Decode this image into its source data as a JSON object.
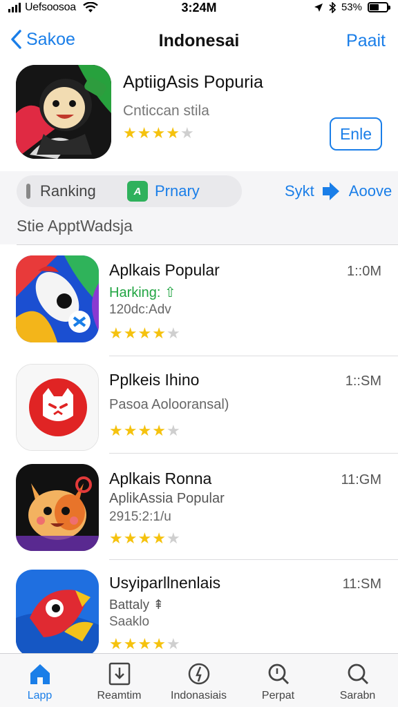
{
  "status_bar": {
    "carrier": "Uefsoosoa",
    "time": "3:24M",
    "battery_percent": "53%",
    "battery_level": 0.53
  },
  "nav": {
    "back_label": "Sakoe",
    "title": "Indonesai",
    "action_label": "Paait"
  },
  "featured": {
    "name": "AptiigAsis Popuria",
    "subtitle": "Cnticcan stila",
    "rating": 4,
    "open_label": "Enle"
  },
  "filters": {
    "ranking_label": "Ranking",
    "primary_badge": "A",
    "primary_label": "Prnary",
    "sort_label": "Sykt",
    "above_label": "Aoove",
    "section_title": "Stie ApptWadsja"
  },
  "apps": [
    {
      "name": "Aplkais Popular",
      "line2": "Harking: ⇧",
      "line3": "120dc:Adv",
      "size": "1::0M",
      "rating": 4
    },
    {
      "name": "Pplkeis Ihino",
      "line2": "",
      "line3": "Pasoa Aolooransal)",
      "size": "1::SM",
      "rating": 4
    },
    {
      "name": "Aplkais Ronna",
      "line2": "AplikAssia Popular",
      "line3": "2915:2:1/u",
      "size": "11:GM",
      "rating": 4
    },
    {
      "name": "Usyiparllnenlais",
      "line2": "Battaly ⇞",
      "line3": "Saaklo",
      "size": "11:SM",
      "rating": 4
    }
  ],
  "tabs": [
    {
      "label": "Lapp",
      "icon": "home-icon",
      "active": true
    },
    {
      "label": "Reamtim",
      "icon": "download-icon",
      "active": false
    },
    {
      "label": "Indonasiais",
      "icon": "clock-icon",
      "active": false
    },
    {
      "label": "Perpat",
      "icon": "search-icon",
      "active": false
    },
    {
      "label": "Sarabn",
      "icon": "search-icon",
      "active": false
    }
  ],
  "colors": {
    "accent": "#1a7ee8",
    "star": "#f5c20e",
    "green": "#22a543"
  }
}
